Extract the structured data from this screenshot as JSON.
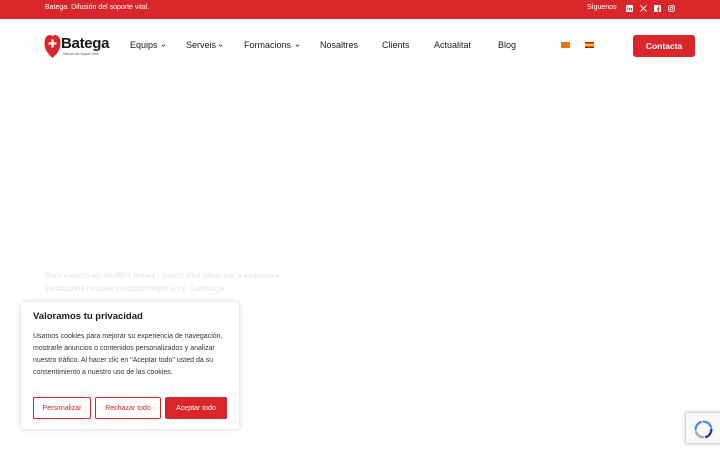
{
  "topbar": {
    "tagline": "Batega. Difusión del soporte vital.",
    "follow_label": "Síguenos",
    "social_icons": [
      "linkedin-icon",
      "x-twitter-icon",
      "facebook-icon",
      "instagram-icon"
    ]
  },
  "header": {
    "logo": {
      "word": "Batega",
      "sub": "Difusió del Suport Vital"
    },
    "nav": {
      "equips": "Equips",
      "serveis": "Serveis",
      "formacions": "Formacions",
      "nosaltres": "Nosaltres",
      "clients": "Clients",
      "actualitat": "Actualitat",
      "blog": "Blog"
    },
    "languages": [
      "Català",
      "Español"
    ],
    "contact_label": "Contacta"
  },
  "hero": {
    "faded_line_1": "Som experts en desfibril·ladors i suport vital bàsic per a empreses,",
    "faded_line_2": "institucions i espais cardioprotegits a tot Catalunya."
  },
  "cookie_banner": {
    "title": "Valoramos tu privacidad",
    "body": "Usamos cookies para mejorar su experiencia de navegación, mostrarle anuncios o contenidos personalizados y analizar nuestro tráfico. Al hacer clic en \"Aceptar todo\" usted da su consentimiento a nuestro uso de las cookies.",
    "customize_label": "Personalizar",
    "reject_label": "Rechazar todo",
    "accept_label": "Aceptar todo"
  },
  "colors": {
    "brand_red": "#d8262b",
    "text_dark": "#1a1a1a"
  }
}
